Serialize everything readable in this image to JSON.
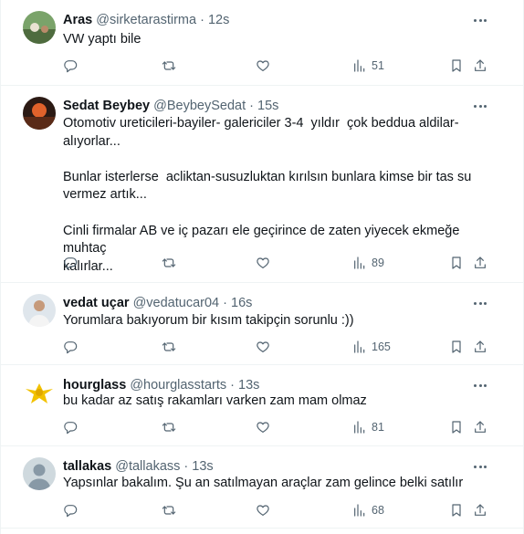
{
  "tweets": [
    {
      "name": "Aras",
      "handle": "@sirketarastirma",
      "time": "12s",
      "lines": [
        "VW yaptı bile"
      ],
      "views": "51",
      "avatar_color": "#6b8f5a"
    },
    {
      "name": "Sedat Beybey",
      "handle": "@BeybeySedat",
      "time": "15s",
      "lines": [
        "Otomotiv ureticileri-bayiler- galericiler 3-4  yıldır  çok beddua aldilar-",
        "alıyorlar...",
        "",
        "Bunlar isterlerse  acliktan-susuzluktan kırılsın bunlara kimse bir tas su",
        "vermez artık...",
        "",
        "Cinli firmalar AB ve iç pazarı ele geçirince de zaten yiyecek ekmeğe muhtaç",
        "kalırlar..."
      ],
      "views": "89",
      "avatar_color": "#8a3a1e"
    },
    {
      "name": "vedat uçar",
      "handle": "@vedatucar04",
      "time": "16s",
      "lines": [
        "Yorumlara bakıyorum bir kısım takipçin sorunlu :))"
      ],
      "views": "165",
      "avatar_color": "#c9d3dc"
    },
    {
      "name": "hourglass",
      "handle": "@hourglasstarts",
      "time": "13s",
      "lines": [
        "bu kadar az satış rakamları varken zam mam olmaz"
      ],
      "views": "81",
      "avatar_color": "#f2c200"
    },
    {
      "name": "tallakas",
      "handle": "@tallakass",
      "time": "13s",
      "lines": [
        "Yapsınlar bakalım. Şu an satılmayan araçlar zam gelince belki satılır"
      ],
      "views": "68",
      "avatar_color": "#cfd9de"
    }
  ],
  "separator": "·",
  "icons": {
    "more": "more-dots-icon",
    "reply": "reply-icon",
    "retweet": "retweet-icon",
    "like": "heart-icon",
    "views": "views-chart-icon",
    "bookmark": "bookmark-icon",
    "share": "share-icon"
  }
}
